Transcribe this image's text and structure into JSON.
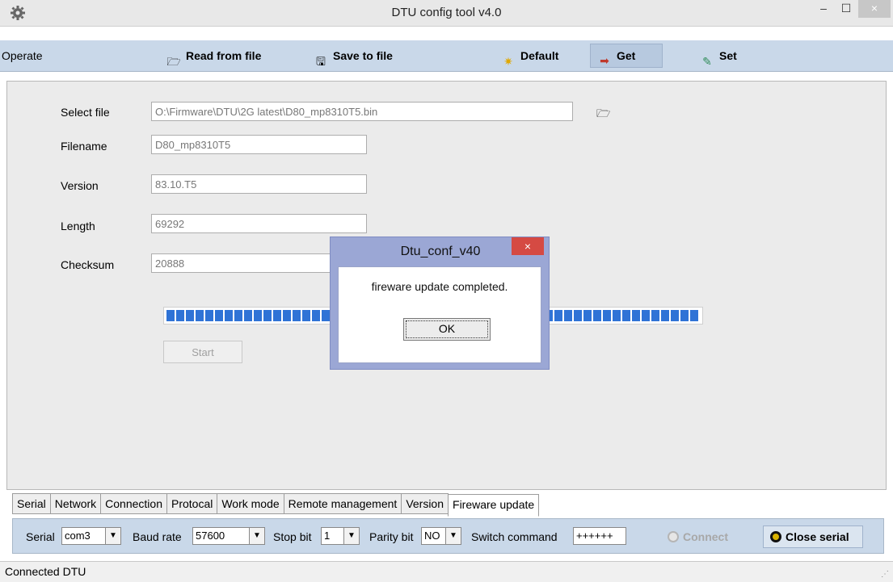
{
  "window": {
    "title": "DTU config tool v4.0",
    "icon": "gear-icon",
    "controls": {
      "minimize": "–",
      "maximize": "☐",
      "close": "×"
    }
  },
  "toolbar": {
    "operate_label": "Operate",
    "read_from_file": "Read from file",
    "save_to_file": "Save to file",
    "default": "Default",
    "get": "Get",
    "set": "Set"
  },
  "form": {
    "select_file_label": "Select file",
    "select_file_value": "O:\\Firmware\\DTU\\2G latest\\D80_mp8310T5.bin",
    "filename_label": "Filename",
    "filename_value": "D80_mp8310T5",
    "version_label": "Version",
    "version_value": "83.10.T5",
    "length_label": "Length",
    "length_value": "69292",
    "checksum_label": "Checksum",
    "checksum_value": "20888",
    "progress_fraction": 1.0,
    "start_button": "Start"
  },
  "dialog": {
    "title": "Dtu_conf_v40",
    "message": "fireware update completed.",
    "ok_button": "OK",
    "close": "×"
  },
  "tabs": [
    {
      "label": "Serial"
    },
    {
      "label": "Network"
    },
    {
      "label": "Connection"
    },
    {
      "label": "Protocal"
    },
    {
      "label": "Work mode"
    },
    {
      "label": "Remote management"
    },
    {
      "label": "Version"
    },
    {
      "label": "Fireware update",
      "active": true
    }
  ],
  "serial": {
    "serial_label": "Serial",
    "serial_value": "com3",
    "baud_label": "Baud rate",
    "baud_value": "57600",
    "stop_label": "Stop bit",
    "stop_value": "1",
    "parity_label": "Parity bit",
    "parity_value": "NO",
    "switch_label": "Switch command",
    "switch_value": "++++++",
    "connect_button": "Connect",
    "close_serial_button": "Close serial"
  },
  "status": {
    "text": "Connected DTU"
  },
  "colors": {
    "toolbar_bg": "#c9d8e9",
    "progress": "#2f73d6",
    "dialog_frame": "#9ba7d5",
    "close_red": "#d54a43"
  }
}
